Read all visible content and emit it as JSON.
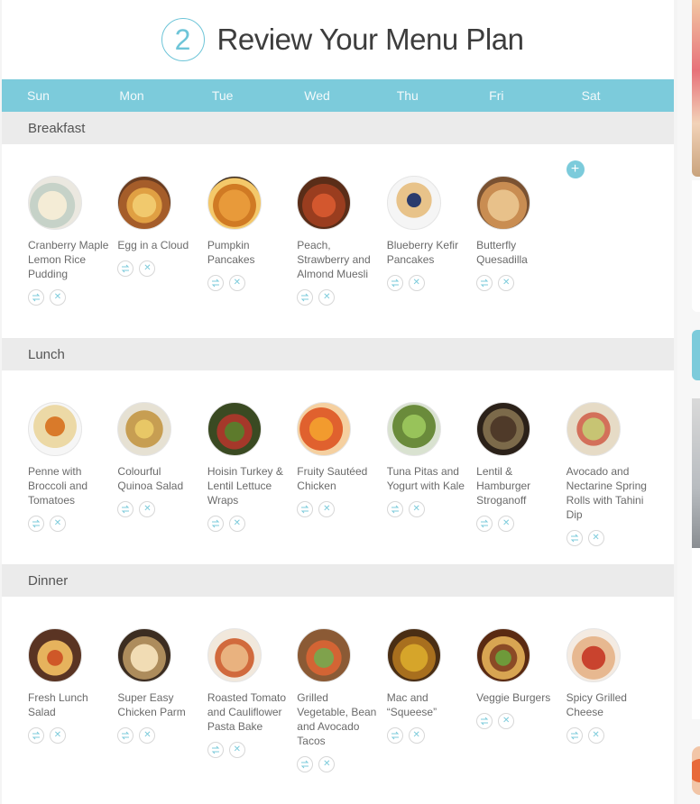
{
  "header": {
    "step": "2",
    "title": "Review Your Menu Plan"
  },
  "days": [
    "Sun",
    "Mon",
    "Tue",
    "Wed",
    "Thu",
    "Fri",
    "Sat"
  ],
  "breakfast": {
    "label": "Breakfast",
    "items": [
      {
        "name": "Cranberry Maple Lemon Rice Pudding"
      },
      {
        "name": "Egg in a Cloud"
      },
      {
        "name": "Pumpkin Pancakes"
      },
      {
        "name": "Peach, Strawberry and Almond Muesli"
      },
      {
        "name": "Blueberry Kefir Pancakes"
      },
      {
        "name": "Butterfly Quesadilla"
      }
    ],
    "add_label": "+"
  },
  "lunch": {
    "label": "Lunch",
    "items": [
      {
        "name": "Penne with Broccoli and Tomatoes"
      },
      {
        "name": "Colourful Quinoa Salad"
      },
      {
        "name": "Hoisin Turkey & Lentil Lettuce Wraps"
      },
      {
        "name": "Fruity Sautéed Chicken"
      },
      {
        "name": "Tuna Pitas and Yogurt with Kale"
      },
      {
        "name": "Lentil & Hamburger Stroganoff"
      },
      {
        "name": "Avocado and Nectarine Spring Rolls with Tahini Dip"
      }
    ]
  },
  "dinner": {
    "label": "Dinner",
    "items": [
      {
        "name": "Fresh Lunch Salad"
      },
      {
        "name": "Super Easy Chicken Parm"
      },
      {
        "name": "Roasted Tomato and Cauliflower Pasta Bake"
      },
      {
        "name": "Grilled Vegetable, Bean and Avocado Tacos"
      },
      {
        "name": "Mac and “Squeese”"
      },
      {
        "name": "Veggie Burgers"
      },
      {
        "name": "Spicy Grilled Cheese"
      }
    ]
  },
  "icons": {
    "swap": "swap-icon",
    "remove": "remove-icon",
    "add": "add-icon"
  },
  "colors": {
    "accent": "#7ccbdb",
    "section_bg": "#ebebeb",
    "text": "#6a6a6a"
  }
}
